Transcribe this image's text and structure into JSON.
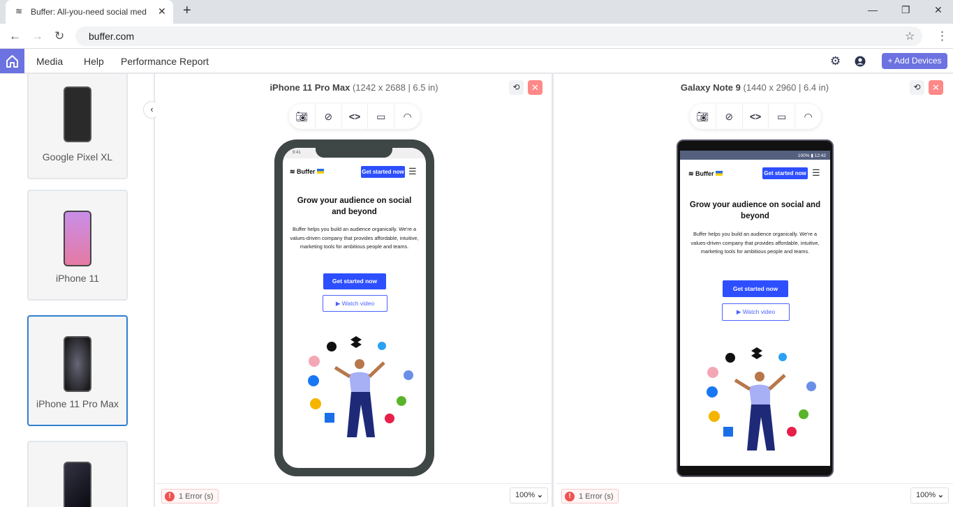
{
  "browser": {
    "tab_title": "Buffer: All-you-need social media toolkit for small businesses",
    "url": "buffer.com"
  },
  "appbar": {
    "menu": [
      "Media",
      "Help",
      "Performance Report"
    ],
    "add_devices": "+ Add Devices"
  },
  "sidebar": {
    "devices": [
      {
        "label": "Google Pixel XL",
        "selected": false
      },
      {
        "label": "iPhone 11",
        "selected": false
      },
      {
        "label": "iPhone 11 Pro Max",
        "selected": true
      },
      {
        "label": "",
        "selected": false
      }
    ]
  },
  "panels": [
    {
      "name": "iPhone 11 Pro Max",
      "specs": "(1242 x 2688 | 6.5 in)",
      "status_time": "9:41",
      "errors": "1 Error (s)",
      "zoom": "100%"
    },
    {
      "name": "Galaxy Note 9",
      "specs": "(1440 x 2960 | 6.4 in)",
      "status_time": "12:42",
      "battery": "100%",
      "errors": "1 Error (s)",
      "zoom": "100%"
    }
  ],
  "site": {
    "logo": "Buffer",
    "cta": "Get started now",
    "headline": "Grow your audience on social and beyond",
    "body": "Buffer helps you build an audience organically. We're a values-driven company that provides affordable, intuitive, marketing tools for ambitious people and teams.",
    "primary": "Get started now",
    "secondary": "Watch video"
  },
  "colors": {
    "accent": "#6c72e0",
    "cta": "#2d4fff",
    "error": "#f05252",
    "selected_border": "#2f7fd1"
  }
}
